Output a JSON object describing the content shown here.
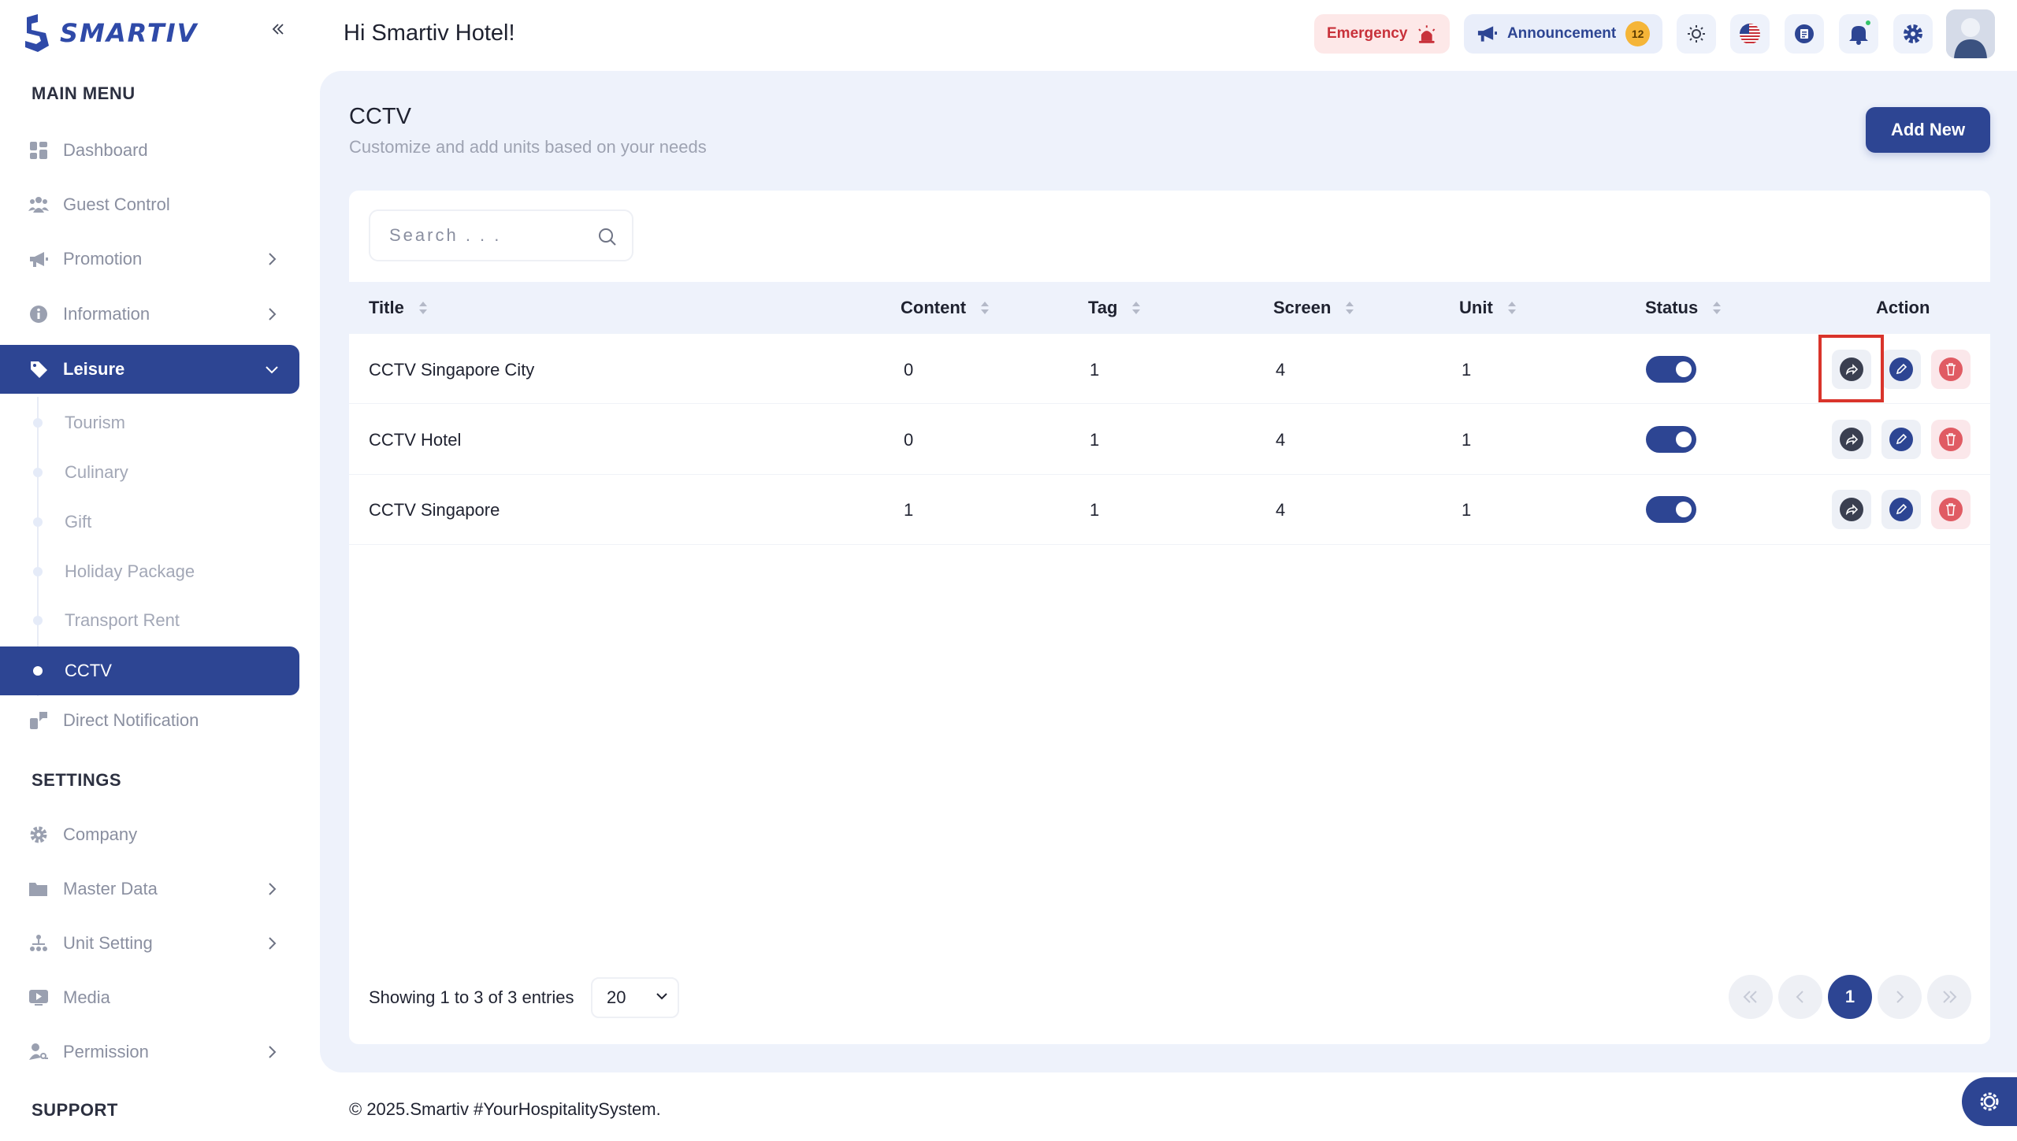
{
  "brand": {
    "name": "SMARTIV"
  },
  "header": {
    "greeting": "Hi Smartiv Hotel!",
    "emergency_label": "Emergency",
    "announcement_label": "Announcement",
    "announcement_count": "12"
  },
  "sidebar": {
    "main_menu_title": "MAIN MENU",
    "items": [
      {
        "label": "Dashboard"
      },
      {
        "label": "Guest Control"
      },
      {
        "label": "Promotion"
      },
      {
        "label": "Information"
      },
      {
        "label": "Leisure"
      }
    ],
    "leisure_sub": [
      {
        "label": "Tourism"
      },
      {
        "label": "Culinary"
      },
      {
        "label": "Gift"
      },
      {
        "label": "Holiday Package"
      },
      {
        "label": "Transport Rent"
      },
      {
        "label": "CCTV"
      }
    ],
    "direct_notification": "Direct Notification",
    "settings_title": "SETTINGS",
    "settings_items": [
      {
        "label": "Company"
      },
      {
        "label": "Master Data"
      },
      {
        "label": "Unit Setting"
      },
      {
        "label": "Media"
      },
      {
        "label": "Permission"
      }
    ],
    "support_title": "SUPPORT"
  },
  "page": {
    "title": "CCTV",
    "subtitle": "Customize and add units based on your needs",
    "add_button": "Add New"
  },
  "search": {
    "placeholder": "Search . . ."
  },
  "table": {
    "columns": [
      "Title",
      "Content",
      "Tag",
      "Screen",
      "Unit",
      "Status",
      "Action"
    ],
    "rows": [
      {
        "title": "CCTV Singapore City",
        "content": "0",
        "tag": "1",
        "screen": "4",
        "unit": "1",
        "status": true
      },
      {
        "title": "CCTV Hotel",
        "content": "0",
        "tag": "1",
        "screen": "4",
        "unit": "1",
        "status": true
      },
      {
        "title": "CCTV Singapore",
        "content": "1",
        "tag": "1",
        "screen": "4",
        "unit": "1",
        "status": true
      }
    ]
  },
  "pagination": {
    "info": "Showing 1 to 3 of 3 entries",
    "page_size": "20",
    "current_page": "1"
  },
  "footer": {
    "copyright": "© 2025.Smartiv #YourHospitalitySystem."
  },
  "colors": {
    "primary": "#2d4593",
    "background": "#eef2fb",
    "danger": "#e05b63",
    "warning": "#f5b538"
  }
}
